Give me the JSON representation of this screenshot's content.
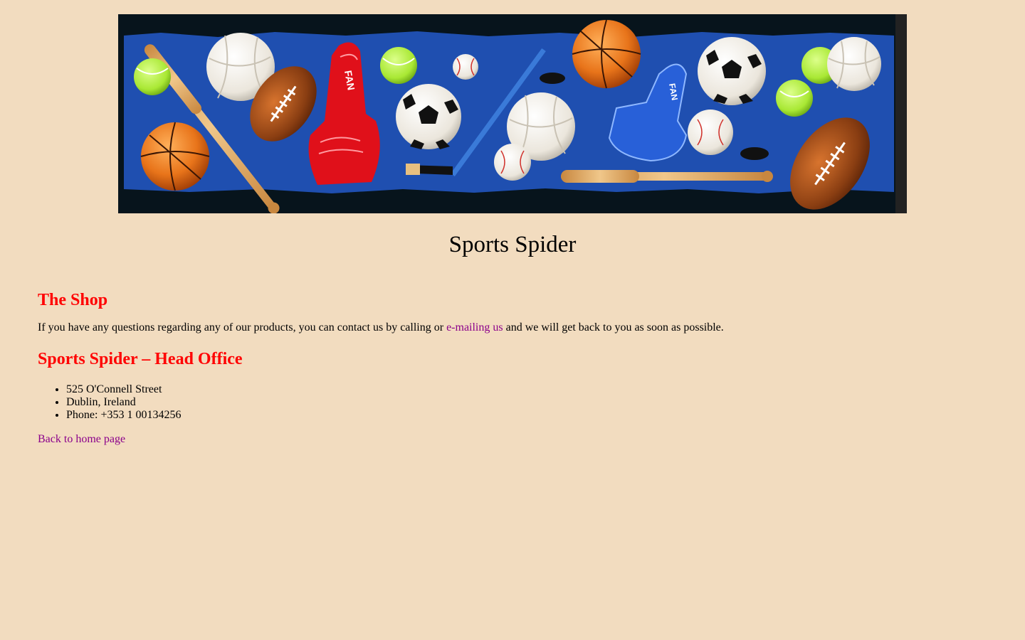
{
  "site": {
    "title": "Sports Spider"
  },
  "banner": {
    "image_label": "FAN",
    "colors": {
      "background": "#1f4fb0",
      "frame": "#07141c",
      "foam_finger_red": "#e0101a",
      "foam_finger_blue": "#1e5ae0",
      "basketball": "#e8741a",
      "tennis_ball": "#a9e834",
      "football": "#8a3e12"
    }
  },
  "shop": {
    "heading": "The Shop",
    "intro_before": "If you have any questions regarding any of our products, you can contact us by calling or ",
    "email_link": "e-mailing us",
    "intro_after": " and we will get back to you as soon as possible."
  },
  "office": {
    "heading": "Sports Spider – Head Office",
    "address": [
      "525 O'Connell Street",
      "Dublin, Ireland",
      "Phone: +353 1 00134256"
    ]
  },
  "nav": {
    "back_home": "Back to home page"
  },
  "colors": {
    "page_background": "#f2dcbf",
    "heading": "#ff0000",
    "link": "#8b008b"
  }
}
